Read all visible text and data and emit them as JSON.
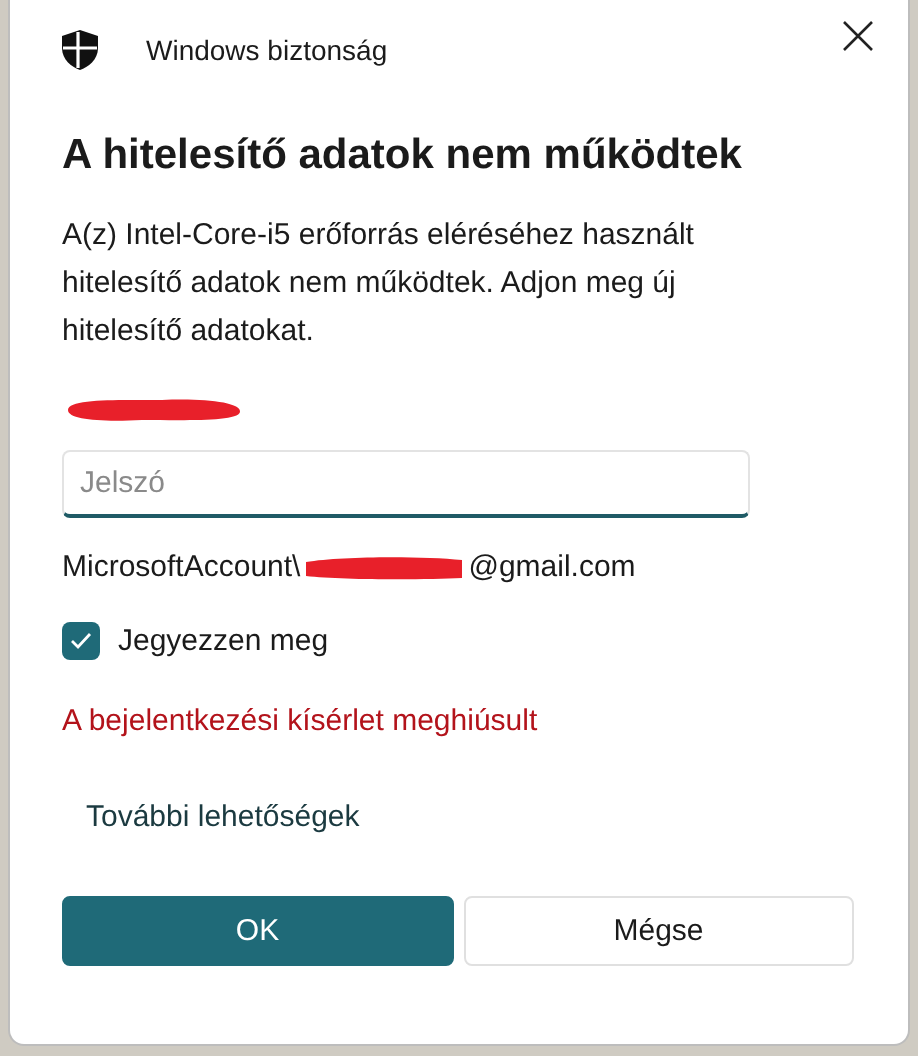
{
  "window": {
    "title": "Windows biztonság"
  },
  "heading": "A hitelesítő adatok nem működtek",
  "message": "A(z) Intel-Core-i5 erőforrás eléréséhez használt hitelesítő adatok nem működtek. Adjon meg új hitelesítő adatokat.",
  "password": {
    "placeholder": "Jelszó"
  },
  "account": {
    "prefix": "MicrosoftAccount\\",
    "suffix": "@gmail.com"
  },
  "remember": {
    "label": "Jegyezzen meg",
    "checked": true
  },
  "error": "A bejelentkezési kísérlet meghiúsult",
  "more_options": "További lehetőségek",
  "buttons": [
    {
      "label": "OK",
      "kind": "primary"
    },
    {
      "label": "Mégse",
      "kind": "secondary"
    }
  ]
}
